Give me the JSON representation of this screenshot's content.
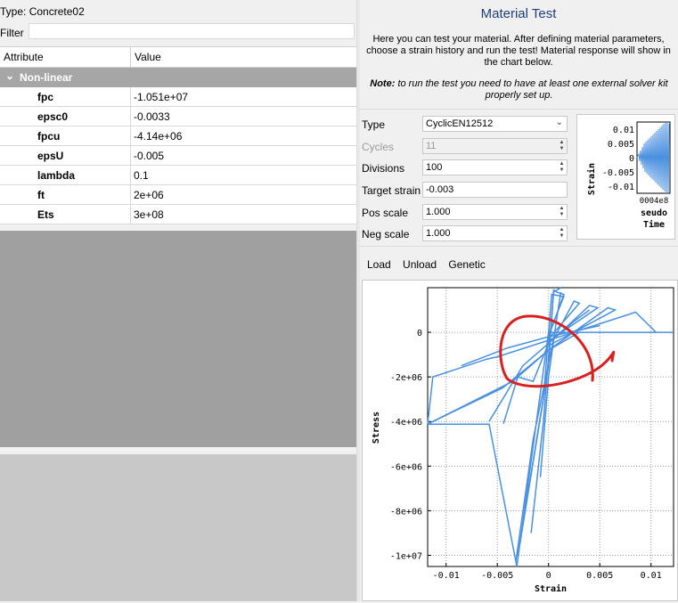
{
  "left": {
    "type_label": "Type:",
    "type_value": "Concrete02",
    "filter_label": "Filter",
    "columns": [
      "Attribute",
      "Value"
    ],
    "group": "Non-linear",
    "rows": [
      {
        "attr": "fpc",
        "value": "-1.051e+07"
      },
      {
        "attr": "epsc0",
        "value": "-0.0033"
      },
      {
        "attr": "fpcu",
        "value": "-4.14e+06"
      },
      {
        "attr": "epsU",
        "value": "-0.005"
      },
      {
        "attr": "lambda",
        "value": "0.1"
      },
      {
        "attr": "ft",
        "value": "2e+06"
      },
      {
        "attr": "Ets",
        "value": "3e+08"
      }
    ]
  },
  "right": {
    "title": "Material Test",
    "description": "Here you can test your material. After defining material parameters, choose a strain history and run the test! Material response will show in the chart below.",
    "note_label": "Note:",
    "note_text": "to run the test you need to have at least one external solver kit properly set up.",
    "fields": {
      "type_label": "Type",
      "type_value": "CyclicEN12512",
      "cycles_label": "Cycles",
      "cycles_value": "11",
      "divisions_label": "Divisions",
      "divisions_value": "100",
      "target_label": "Target strain",
      "target_value": "-0.003",
      "pos_label": "Pos scale",
      "pos_value": "1.000",
      "neg_label": "Neg scale",
      "neg_value": "1.000"
    },
    "tabs": [
      "Load",
      "Unload",
      "Genetic"
    ]
  },
  "mini_chart": {
    "ylabel": "Strain",
    "xlabel_lines": [
      "0004e8",
      "seudo",
      "Time"
    ],
    "yticks": [
      "0.01",
      "0.005",
      "0",
      "-0.005",
      "-0.01"
    ]
  },
  "chart_data": {
    "type": "line",
    "xlabel": "Strain",
    "ylabel": "Stress",
    "xticks": [
      "-0.01",
      "-0.005",
      "0",
      "0.005",
      "0.01"
    ],
    "yticks": [
      "0",
      "-2e+06",
      "-4e+06",
      "-6e+06",
      "-8e+06",
      "-1e+07"
    ],
    "xlim": [
      -0.0118,
      0.0122
    ],
    "ylim": [
      -10500000,
      2000000
    ],
    "grid": true,
    "color": "#4a90e0",
    "annotation_color": "#d92020",
    "series": [
      {
        "x": [
          -0.0118,
          -0.0058,
          -0.0058,
          -0.0031,
          0.0,
          0.0122
        ],
        "y": [
          -4120000,
          -4120000,
          -4120000,
          -10500000,
          0,
          0
        ]
      },
      {
        "x": [
          -0.0118,
          -0.0113,
          -0.006,
          -0.005,
          0.0085,
          0.0105
        ],
        "y": [
          -4120000,
          -2000000,
          -1200000,
          -1100000,
          900000,
          0
        ]
      },
      {
        "x": [
          -0.0118,
          -0.0035,
          0.0,
          0.0058,
          0.0065,
          0.0
        ],
        "y": [
          -4120000,
          -2200000,
          -800000,
          1100000,
          1000000,
          -600000
        ]
      },
      {
        "x": [
          -0.0058,
          -0.0025,
          0.0,
          0.004,
          0.0048,
          0.0
        ],
        "y": [
          -4000000,
          -1500000,
          -500000,
          1200000,
          1100000,
          -400000
        ]
      },
      {
        "x": [
          -0.0032,
          -0.0015,
          0.0005,
          0.0025,
          0.003,
          0.0
        ],
        "y": [
          -10300000,
          -4800000,
          -300000,
          1400000,
          1300000,
          -300000
        ]
      },
      {
        "x": [
          -0.003,
          0.0,
          0.0005,
          0.0008,
          0.0015,
          0.0
        ],
        "y": [
          -10000000,
          -1500000,
          1900000,
          1800000,
          1700000,
          -200000
        ]
      },
      {
        "x": [
          -0.0028,
          -0.0005,
          0.0003,
          0.0015,
          0.0
        ],
        "y": [
          -9500000,
          -3000000,
          1700000,
          1600000,
          -100000
        ]
      },
      {
        "x": [
          -0.0044,
          -0.003,
          -0.0015,
          0.0,
          0.0025,
          0.004
        ],
        "y": [
          -4100000,
          -2000000,
          -2200000,
          -500000,
          500000,
          1000000
        ]
      },
      {
        "x": [
          -0.0118,
          -0.0095,
          -0.0045,
          0.0,
          0.003
        ],
        "y": [
          -4120000,
          -3600000,
          -2500000,
          -800000,
          0
        ]
      },
      {
        "x": [
          -0.0085,
          -0.004,
          0.0,
          0.005
        ],
        "y": [
          -1500000,
          -700000,
          -200000,
          300000
        ]
      },
      {
        "x": [
          -0.0008,
          0.0,
          0.0007,
          0.0012
        ],
        "y": [
          -6500000,
          -2000000,
          300000,
          1800000
        ]
      },
      {
        "x": [
          -0.0017,
          -0.0005,
          0.0005,
          0.0012
        ],
        "y": [
          -9000000,
          -4000000,
          1800000,
          2000000
        ]
      }
    ]
  }
}
